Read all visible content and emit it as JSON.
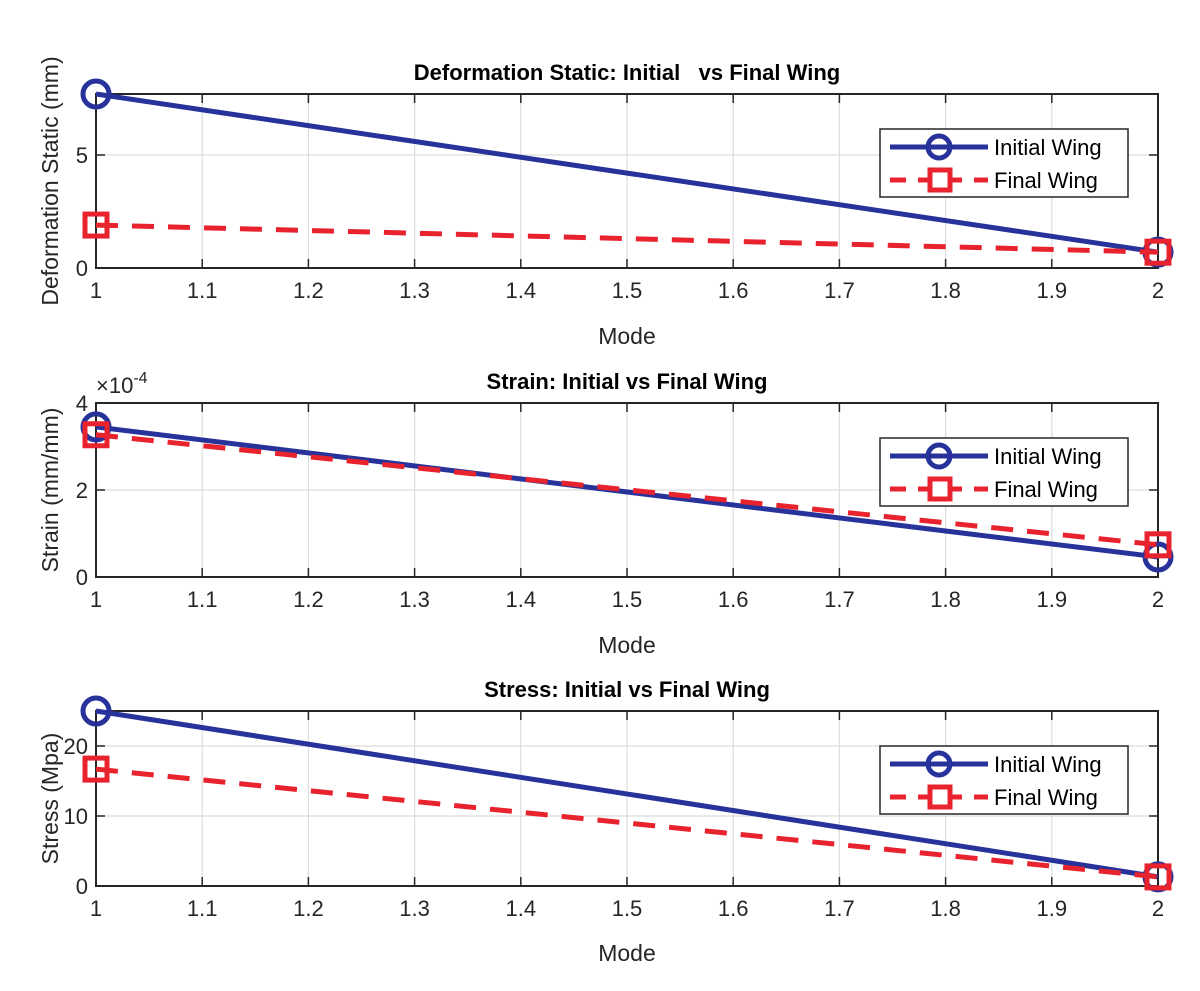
{
  "colors": {
    "initial": "#27329a",
    "final": "#e8232e",
    "grid": "#dcdcdc",
    "axis": "#262626"
  },
  "chart_data": [
    {
      "type": "line",
      "title": "Deformation Static: Initial   vs Final Wing",
      "xlabel": "Mode",
      "ylabel": "Deformation Static (mm)",
      "x": [
        1,
        2
      ],
      "xlim": [
        1,
        2
      ],
      "ylim": [
        0,
        7.7
      ],
      "xticks": [
        1,
        1.1,
        1.2,
        1.3,
        1.4,
        1.5,
        1.6,
        1.7,
        1.8,
        1.9,
        2
      ],
      "xtick_labels": [
        "1",
        "1.1",
        "1.2",
        "1.3",
        "1.4",
        "1.5",
        "1.6",
        "1.7",
        "1.8",
        "1.9",
        "2"
      ],
      "yticks": [
        0,
        5
      ],
      "ytick_labels": [
        "0",
        "5"
      ],
      "exponent_label": "",
      "grid": true,
      "legend_position": "top-right",
      "series": [
        {
          "name": "Initial Wing",
          "values": [
            7.7,
            0.7
          ],
          "style": "solid",
          "marker": "circle"
        },
        {
          "name": "Final Wing",
          "values": [
            1.9,
            0.7
          ],
          "style": "dashed",
          "marker": "square"
        }
      ]
    },
    {
      "type": "line",
      "title": "Strain: Initial vs Final Wing",
      "xlabel": "Mode",
      "ylabel": "Strain (mm/mm)",
      "x": [
        1,
        2
      ],
      "xlim": [
        1,
        2
      ],
      "ylim": [
        0,
        0.0004
      ],
      "xticks": [
        1,
        1.1,
        1.2,
        1.3,
        1.4,
        1.5,
        1.6,
        1.7,
        1.8,
        1.9,
        2
      ],
      "xtick_labels": [
        "1",
        "1.1",
        "1.2",
        "1.3",
        "1.4",
        "1.5",
        "1.6",
        "1.7",
        "1.8",
        "1.9",
        "2"
      ],
      "yticks": [
        0,
        0.0002,
        0.0004
      ],
      "ytick_labels": [
        "0",
        "2",
        "4"
      ],
      "exponent_label": "×10",
      "exponent_power": "-4",
      "grid": true,
      "legend_position": "top-right",
      "series": [
        {
          "name": "Initial Wing",
          "values": [
            0.000345,
            4.6e-05
          ],
          "style": "solid",
          "marker": "circle"
        },
        {
          "name": "Final Wing",
          "values": [
            0.000327,
            7.4e-05
          ],
          "style": "dashed",
          "marker": "square"
        }
      ]
    },
    {
      "type": "line",
      "title": "Stress: Initial vs Final Wing",
      "xlabel": "Mode",
      "ylabel": "Stress (Mpa)",
      "x": [
        1,
        2
      ],
      "xlim": [
        1,
        2
      ],
      "ylim": [
        0,
        25
      ],
      "xticks": [
        1,
        1.1,
        1.2,
        1.3,
        1.4,
        1.5,
        1.6,
        1.7,
        1.8,
        1.9,
        2
      ],
      "xtick_labels": [
        "1",
        "1.1",
        "1.2",
        "1.3",
        "1.4",
        "1.5",
        "1.6",
        "1.7",
        "1.8",
        "1.9",
        "2"
      ],
      "yticks": [
        0,
        10,
        20
      ],
      "ytick_labels": [
        "0",
        "10",
        "20"
      ],
      "exponent_label": "",
      "grid": true,
      "legend_position": "top-right",
      "series": [
        {
          "name": "Initial Wing",
          "values": [
            25.0,
            1.3
          ],
          "style": "solid",
          "marker": "circle"
        },
        {
          "name": "Final Wing",
          "values": [
            16.7,
            1.3
          ],
          "style": "dashed",
          "marker": "square"
        }
      ]
    }
  ]
}
